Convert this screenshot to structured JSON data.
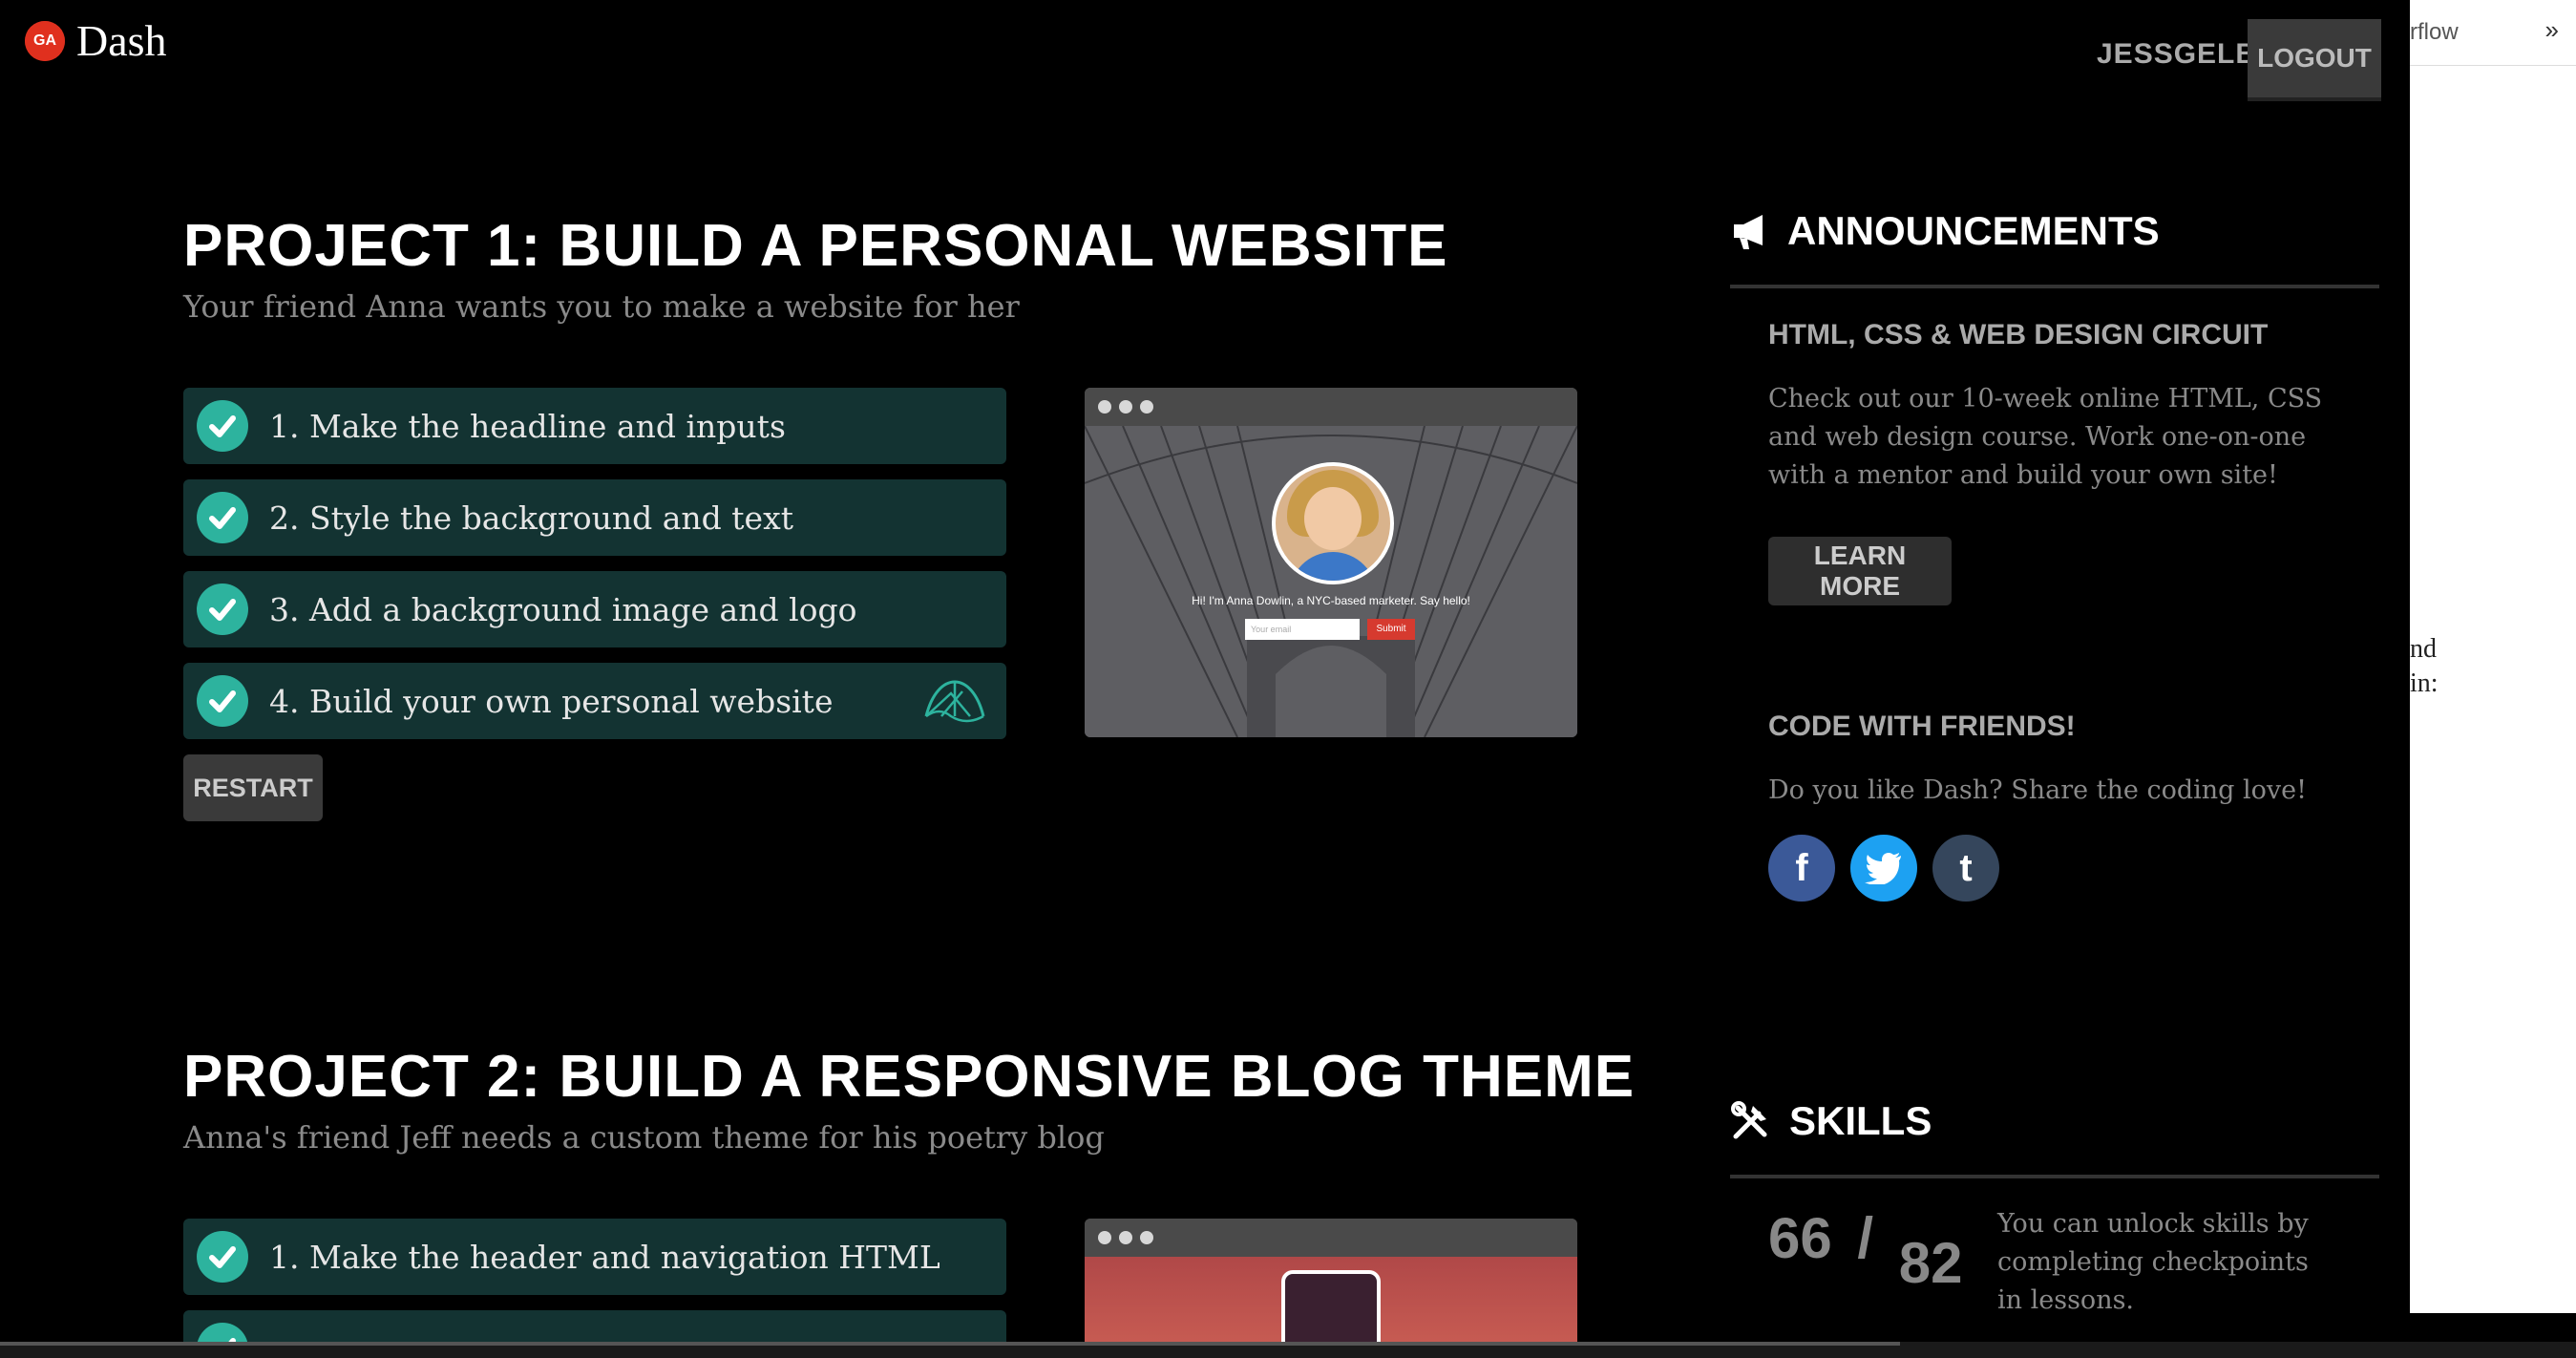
{
  "header": {
    "logo_badge": "GA",
    "app_name": "Dash",
    "username": "JESSGELBS",
    "logout_label": "LOGOUT"
  },
  "projects": [
    {
      "title": "PROJECT 1: BUILD A PERSONAL WEBSITE",
      "subtitle": "Your friend Anna wants you to make a website for her",
      "steps": [
        {
          "label": "1. Make the headline and inputs",
          "completed": true
        },
        {
          "label": "2. Style the background and text",
          "completed": true
        },
        {
          "label": "3. Add a background image and logo",
          "completed": true
        },
        {
          "label": "4. Build your own personal website",
          "completed": true
        }
      ],
      "restart_label": "RESTART",
      "preview": {
        "headline": "Hi! I'm Anna Dowlin, a NYC-based marketer. Say hello!",
        "email_placeholder": "Your email",
        "submit_label": "Submit"
      }
    },
    {
      "title": "PROJECT 2: BUILD A RESPONSIVE BLOG THEME",
      "subtitle": "Anna's friend Jeff needs a custom theme for his poetry blog",
      "steps": [
        {
          "label": "1. Make the header and navigation HTML",
          "completed": true
        }
      ]
    }
  ],
  "announcements": {
    "heading": "ANNOUNCEMENTS",
    "items": [
      {
        "title": "HTML, CSS & WEB DESIGN CIRCUIT",
        "text": "Check out our 10-week online HTML, CSS and web design course. Work one-on-one with a mentor and build your own site!",
        "button_label": "LEARN MORE"
      },
      {
        "title": "CODE WITH FRIENDS!",
        "text": "Do you like Dash? Share the coding love!"
      }
    ],
    "social": [
      "facebook-icon",
      "twitter-icon",
      "tumblr-icon"
    ]
  },
  "skills": {
    "heading": "SKILLS",
    "unlocked": "66",
    "separator": "/",
    "total": "82",
    "text": "You can unlock skills by completing checkpoints in lessons."
  },
  "side_panel": {
    "crumb": "rflow",
    "chevron": "»",
    "fragment1": "nd",
    "fragment2": "in:"
  },
  "colors": {
    "step_bg": "#133332",
    "check": "#2db39e",
    "facebook": "#3b5998",
    "twitter": "#1da1f2",
    "tumblr": "#35465c",
    "ga_red": "#e0301e"
  }
}
